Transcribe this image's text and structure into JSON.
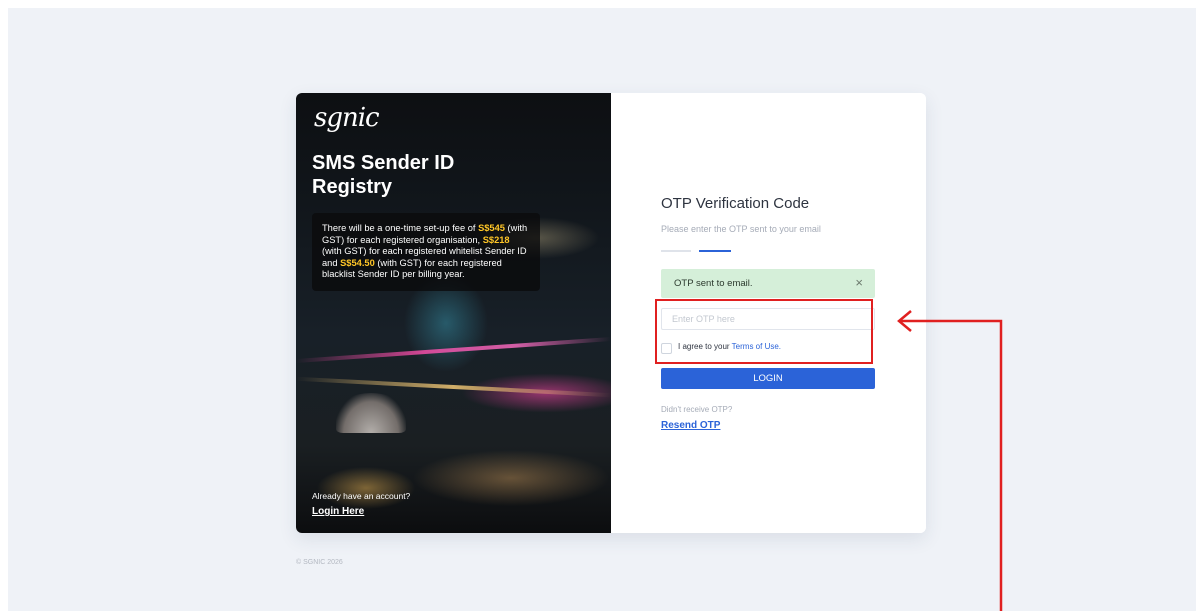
{
  "brand": {
    "logo_text": "sgnic",
    "title": "SMS Sender ID Registry"
  },
  "fee_notice": {
    "part1": "There will be a one-time set-up fee of ",
    "amount1": "S$545",
    "part2": " (with GST) for each registered organisation, ",
    "amount2": "S$218",
    "part3": " (with GST)  for each registered whitelist Sender ID and ",
    "amount3": "S$54.50",
    "part4": " (with GST)  for each registered blacklist Sender ID per billing year."
  },
  "left_footer": {
    "prompt": "Already have an account?",
    "login_link": "Login Here"
  },
  "otp": {
    "title": "OTP Verification Code",
    "subtitle": "Please enter the OTP sent to your email",
    "alert_text": "OTP sent to email.",
    "alert_close": "×",
    "input_placeholder": "Enter OTP here",
    "agree_text": "I agree to your ",
    "terms_link": "Terms of Use.",
    "login_button": "LOGIN",
    "didnt_receive": "Didn't receive OTP?",
    "resend_link": "Resend OTP"
  },
  "footer": {
    "copyright": "© SGNIC 2026"
  },
  "colors": {
    "primary": "#2b63d8",
    "alert_bg": "#d5efd9",
    "highlight": "#ffc627",
    "annotation_red": "#e02020"
  }
}
